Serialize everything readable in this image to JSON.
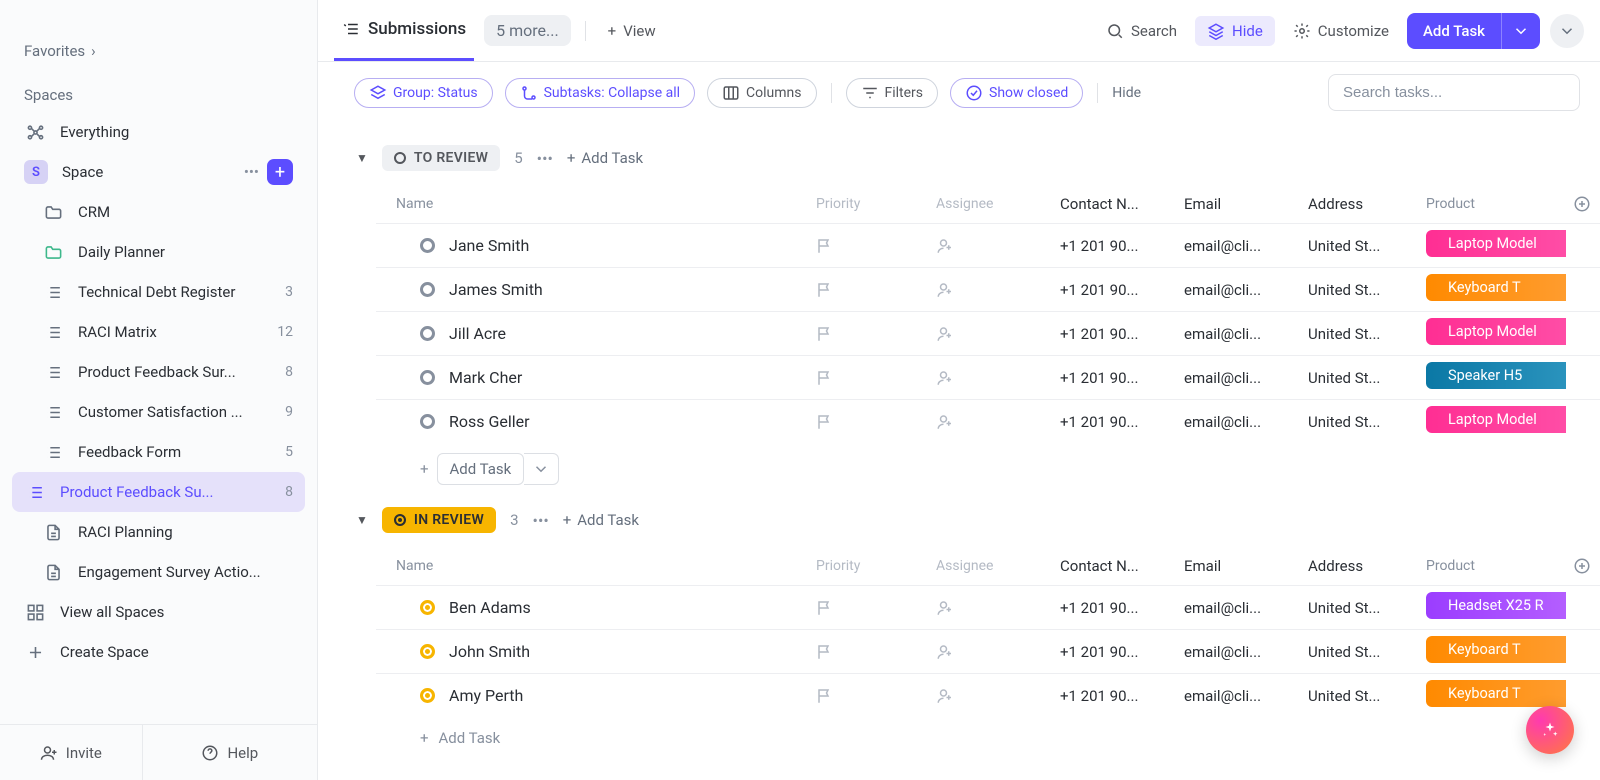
{
  "sidebar": {
    "favorites_label": "Favorites",
    "spaces_label": "Spaces",
    "everything_label": "Everything",
    "space_root": {
      "initial": "S",
      "label": "Space"
    },
    "items": [
      {
        "icon": "folder",
        "label": "CRM",
        "count": ""
      },
      {
        "icon": "folder-green",
        "label": "Daily Planner",
        "count": ""
      },
      {
        "icon": "list",
        "label": "Technical Debt Register",
        "count": "3"
      },
      {
        "icon": "list",
        "label": "RACI Matrix",
        "count": "12"
      },
      {
        "icon": "list",
        "label": "Product Feedback Survey Responses",
        "count": "8",
        "truncated": "Product Feedback Sur..."
      },
      {
        "icon": "list",
        "label": "Customer Satisfaction Survey",
        "count": "9",
        "truncated": "Customer Satisfaction ..."
      },
      {
        "icon": "list",
        "label": "Feedback Form",
        "count": "5"
      },
      {
        "icon": "list",
        "label": "Product Feedback Survey",
        "count": "8",
        "truncated": "Product Feedback Su...",
        "active": true
      },
      {
        "icon": "doc",
        "label": "RACI Planning",
        "count": ""
      },
      {
        "icon": "doc",
        "label": "Engagement Survey Action Plan",
        "count": "",
        "truncated": "Engagement Survey Actio..."
      }
    ],
    "view_all_label": "View all Spaces",
    "create_space_label": "Create Space",
    "invite_label": "Invite",
    "help_label": "Help"
  },
  "toolbar": {
    "view_tab": "Submissions",
    "more_pill": "5 more...",
    "view_btn": "View",
    "search_btn": "Search",
    "hide_btn": "Hide",
    "customize_btn": "Customize",
    "add_task_btn": "Add Task"
  },
  "filterbar": {
    "group_chip": "Group: Status",
    "subtasks_chip": "Subtasks: Collapse all",
    "columns_chip": "Columns",
    "filters_chip": "Filters",
    "closed_chip": "Show closed",
    "hide_text": "Hide",
    "search_placeholder": "Search tasks..."
  },
  "columns": {
    "name": "Name",
    "priority": "Priority",
    "assignee": "Assignee",
    "contact": "Contact N...",
    "email": "Email",
    "address": "Address",
    "product": "Product"
  },
  "groups": [
    {
      "status": "TO REVIEW",
      "style": "review",
      "count": "5",
      "add_label": "Add Task",
      "rows": [
        {
          "name": "Jane Smith",
          "contact": "+1 201 90...",
          "email": "email@cli...",
          "address": "United St...",
          "product": "Laptop Model",
          "pcolor": "pink"
        },
        {
          "name": "James Smith",
          "contact": "+1 201 90...",
          "email": "email@cli...",
          "address": "United St...",
          "product": "Keyboard T",
          "pcolor": "orange"
        },
        {
          "name": "Jill Acre",
          "contact": "+1 201 90...",
          "email": "email@cli...",
          "address": "United St...",
          "product": "Laptop Model",
          "pcolor": "pink"
        },
        {
          "name": "Mark Cher",
          "contact": "+1 201 90...",
          "email": "email@cli...",
          "address": "United St...",
          "product": "Speaker H5",
          "pcolor": "blue"
        },
        {
          "name": "Ross Geller",
          "contact": "+1 201 90...",
          "email": "email@cli...",
          "address": "United St...",
          "product": "Laptop Model",
          "pcolor": "pink"
        }
      ],
      "footer_add": "Add Task"
    },
    {
      "status": "IN REVIEW",
      "style": "inreview",
      "count": "3",
      "add_label": "Add Task",
      "rows": [
        {
          "name": "Ben Adams",
          "contact": "+1 201 90...",
          "email": "email@cli...",
          "address": "United St...",
          "product": "Headset X25 R",
          "pcolor": "purple"
        },
        {
          "name": "John Smith",
          "contact": "+1 201 90...",
          "email": "email@cli...",
          "address": "United St...",
          "product": "Keyboard T",
          "pcolor": "orange"
        },
        {
          "name": "Amy Perth",
          "contact": "+1 201 90...",
          "email": "email@cli...",
          "address": "United St...",
          "product": "Keyboard T",
          "pcolor": "orange"
        }
      ],
      "footer_add": "Add Task"
    }
  ]
}
